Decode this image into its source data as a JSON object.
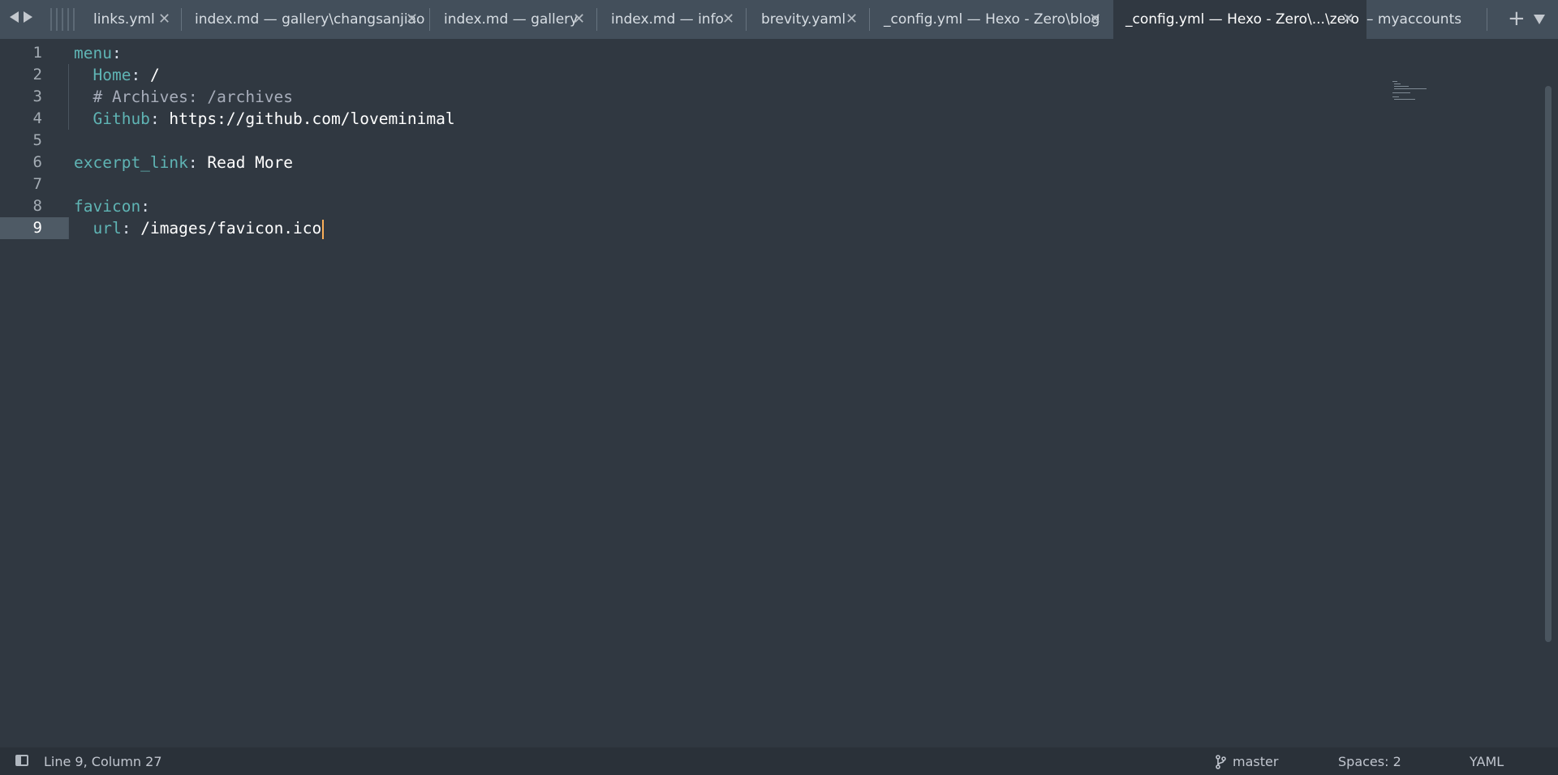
{
  "tabs": [
    {
      "label": "links.yml",
      "close": "✕"
    },
    {
      "label": "index.md — gallery\\changsanjiao",
      "close": "✕"
    },
    {
      "label": "index.md — gallery",
      "close": "✕"
    },
    {
      "label": "index.md — info",
      "close": "✕"
    },
    {
      "label": "brevity.yaml",
      "close": "✕"
    },
    {
      "label": "_config.yml — Hexo - Zero\\blog",
      "close": "✕"
    },
    {
      "label": "_config.yml — Hexo - Zero\\...\\zero",
      "close": "✕",
      "active": true
    },
    {
      "label": "– myaccounts"
    }
  ],
  "tab_add": "+",
  "editor": {
    "line_numbers": [
      "1",
      "2",
      "3",
      "4",
      "5",
      "6",
      "7",
      "8",
      "9"
    ],
    "lines": {
      "l1_key": "menu",
      "l1_colon": ":",
      "l2_key": "Home",
      "l2_colon": ":",
      "l2_val": " /",
      "l3_comment": "# Archives: /archives",
      "l4_key": "Github",
      "l4_colon": ":",
      "l4_val": " https://github.com/loveminimal",
      "l6_key": "excerpt_link",
      "l6_colon": ":",
      "l6_val": " Read More",
      "l8_key": "favicon",
      "l8_colon": ":",
      "l9_key": "url",
      "l9_colon": ":",
      "l9_val": " /images/favicon.ico"
    }
  },
  "status": {
    "position": "Line 9, Column 27",
    "branch": "master",
    "spaces": "Spaces: 2",
    "syntax": "YAML"
  },
  "colors": {
    "background": "#303841",
    "tabbar": "#434f5b",
    "key": "#5fb4b4",
    "caret": "#f9ae58"
  }
}
